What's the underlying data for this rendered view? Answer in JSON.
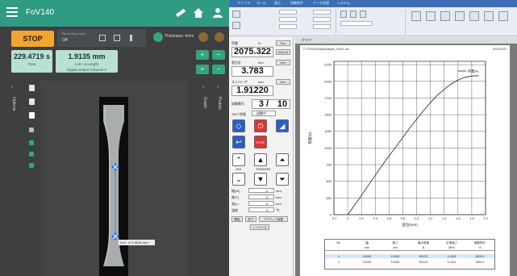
{
  "left_app": {
    "title": "FoV140",
    "stop_label": "STOP",
    "control_label": "Recording mode",
    "control_value": "Off",
    "thickness_text": "Thickness: 4mm",
    "time_value": "229.4719 s",
    "time_label": "Time",
    "length_value": "1.9135 mm",
    "length_label": "Ln0 - Δ Length",
    "length_sub": "Digital Output Channel 0",
    "options_tab": "Options",
    "graph_tab": "Graph",
    "probes_tab": "Probes",
    "overlay_label": "Ln0 - d: 1.9041 mm"
  },
  "right_app": {
    "ribbon_tabs": [
      "ファイル",
      "ホーム",
      "表示",
      "試験条件",
      "データ処理",
      "システム"
    ],
    "panel": {
      "load_label": "荷重",
      "load_unit": "N",
      "load_value": "2075.322",
      "auto_cal": "AutoCal",
      "zero_label": "Zero",
      "disp_label": "変位計",
      "disp_unit": "mm",
      "disp_value": "3.783",
      "stroke_label": "ストローク",
      "stroke_unit": "mm",
      "stroke_value": "1.91220",
      "test_no_label": "試験番号",
      "test_no_value": "3 /",
      "test_no_total": "10",
      "status_label": "TACT状態",
      "status_value": "試験中",
      "stop_btn": "STOP",
      "jog_label": "JOG",
      "traverse_label": "TRAVERSE",
      "fields": [
        {
          "label": "幅(W)",
          "value": "0",
          "unit": "mm"
        },
        {
          "label": "厚(T)",
          "value": "0",
          "unit": "mm"
        },
        {
          "label": "長(L)",
          "value": "0",
          "unit": "mm"
        },
        {
          "label": "温度",
          "value": "0",
          "unit": "℃"
        }
      ],
      "buttons": [
        "開始",
        "終了",
        "アクティブ装置"
      ],
      "subtab": "シーケンス"
    },
    "chart_window_title": "グラフ",
    "paper_header_left": "C:\\TENSILE\\data\\sample_00001.csv",
    "paper_header_right": "2022/11/01",
    "table": {
      "headers": [
        "No.",
        "幅",
        "厚さ",
        "最大荷重",
        "引張強さ",
        "破断伸び"
      ],
      "units": [
        "",
        "mm",
        "mm",
        "N",
        "MPa",
        "%"
      ],
      "rows": [
        [
          "1",
          "0.0000",
          "2.0000",
          "55.572",
          "11.893",
          "5578.0"
        ],
        [
          "2",
          "0.0000",
          "2.0000",
          "55.513",
          "11.601",
          "4500.2"
        ]
      ]
    }
  },
  "chart_data": {
    "type": "line",
    "series": [
      {
        "name": "荷重(N)",
        "x": [
          0.0,
          0.1,
          0.2,
          0.3,
          0.4,
          0.5,
          0.6,
          0.7,
          0.8,
          0.9,
          1.0,
          1.1,
          1.2,
          1.3,
          1.4,
          1.5,
          1.6,
          1.7,
          1.8,
          1.9
        ],
        "y": [
          0,
          140,
          290,
          440,
          590,
          740,
          880,
          1020,
          1160,
          1300,
          1430,
          1560,
          1680,
          1790,
          1880,
          1960,
          2020,
          2060,
          2080,
          2085
        ]
      }
    ],
    "xlim": [
      -0.2,
      2.0
    ],
    "ylim": [
      0,
      2300
    ],
    "xticks": [
      "-0.2",
      "0",
      "0.2",
      "0.4",
      "0.6",
      "0.8",
      "1.0",
      "1.2",
      "1.4",
      "1.6",
      "1.8",
      "2.0"
    ],
    "yticks": [
      "0",
      "250",
      "500",
      "750",
      "1000",
      "1250",
      "1500",
      "1750",
      "2000",
      "2250"
    ],
    "xlabel": "変位(mm)",
    "ylabel": "荷重(N)",
    "legend_label": "荷重(N)",
    "grid": true,
    "legend_position": "top-right"
  }
}
